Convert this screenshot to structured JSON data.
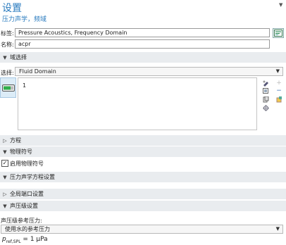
{
  "header": {
    "title": "设置",
    "subtitle": "压力声学，频域"
  },
  "label_row": {
    "caption": "标签:",
    "value": "Pressure Acoustics, Frequency Domain"
  },
  "name_row": {
    "caption": "名称:",
    "value": "acpr"
  },
  "domain_selection": {
    "header": "域选择",
    "selection_caption": "选择:",
    "selection_value": "Fluid Domain",
    "items": [
      "1"
    ]
  },
  "sections": {
    "equation": "方程",
    "physics_symbols": "物理符号",
    "enable_physics_symbols": "启用物理符号",
    "enable_physics_symbols_checked": true,
    "pressure_equation_settings": "压力声学方程设置",
    "global_port_settings": "全局端口设置",
    "sound_pressure_level_settings": "声压级设置"
  },
  "spl": {
    "reference_caption": "声压级参考压力:",
    "reference_value": "使用水的参考压力",
    "pref_symbol": "p",
    "pref_subscript": "ref,SPL",
    "pref_value": "= 1 µPa"
  },
  "icons": {
    "collapse": "triangle-down",
    "form_edit": "form-icon",
    "selection_toggle": "selection-toggle-icon",
    "paste": "paste-icon",
    "copy": "copy-icon",
    "clear": "clear-icon",
    "zoom": "zoom-to-selection-icon",
    "add": "plus-icon",
    "remove": "minus-icon",
    "create_selection": "create-selection-icon"
  }
}
